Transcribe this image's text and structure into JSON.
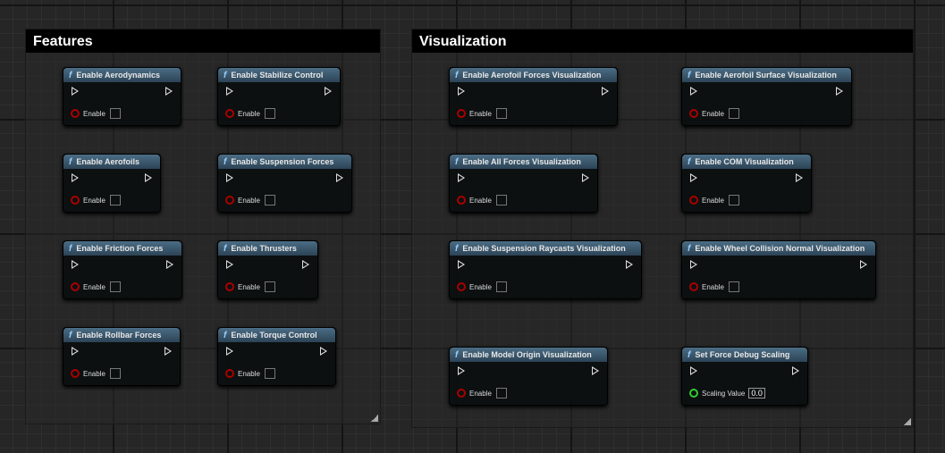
{
  "comments": {
    "features": "Features",
    "visualization": "Visualization"
  },
  "nodes": [
    {
      "title": "Enable Aerodynamics",
      "param": "Enable"
    },
    {
      "title": "Enable Stabilize Control",
      "param": "Enable"
    },
    {
      "title": "Enable Aerofoils",
      "param": "Enable"
    },
    {
      "title": "Enable Suspension Forces",
      "param": "Enable"
    },
    {
      "title": "Enable Friction Forces",
      "param": "Enable"
    },
    {
      "title": "Enable Thrusters",
      "param": "Enable"
    },
    {
      "title": "Enable Rollbar Forces",
      "param": "Enable"
    },
    {
      "title": "Enable Torque Control",
      "param": "Enable"
    },
    {
      "title": "Enable Aerofoil Forces Visualization",
      "param": "Enable"
    },
    {
      "title": "Enable Aerofoil Surface Visualization",
      "param": "Enable"
    },
    {
      "title": "Enable All Forces Visualization",
      "param": "Enable"
    },
    {
      "title": "Enable COM Visualization",
      "param": "Enable"
    },
    {
      "title": "Enable Suspension Raycasts Visualization",
      "param": "Enable"
    },
    {
      "title": "Enable Wheel Collision Normal Visualization",
      "param": "Enable"
    },
    {
      "title": "Enable Model Origin Visualization",
      "param": "Enable"
    },
    {
      "title": "Set Force Debug Scaling",
      "param": "Scaling Value",
      "value": "0.0"
    }
  ],
  "function_icon": "f"
}
